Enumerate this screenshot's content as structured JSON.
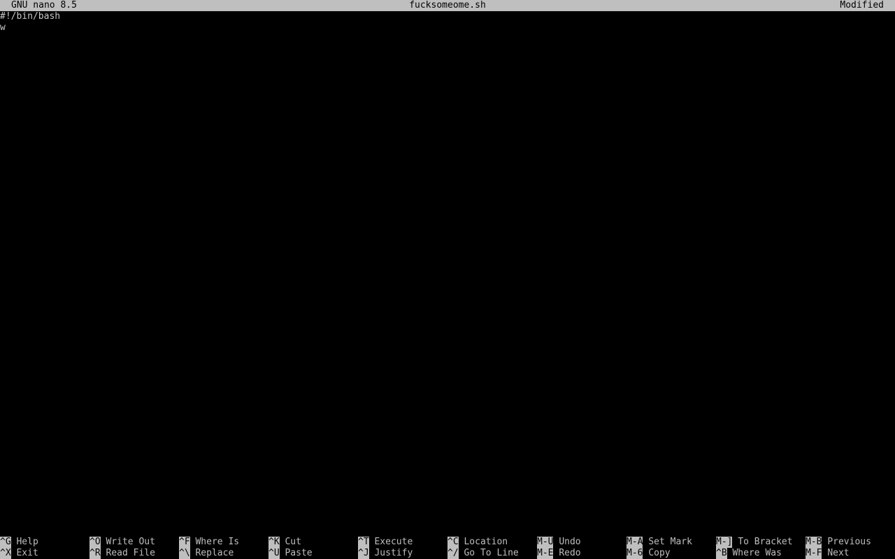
{
  "titlebar": {
    "version": "GNU nano 8.5",
    "filename": "fucksomeome.sh",
    "state": "Modified"
  },
  "editor": {
    "lines": [
      "#!/bin/bash",
      "w"
    ]
  },
  "shortcuts": {
    "row1": [
      {
        "key": "^G",
        "label": "Help"
      },
      {
        "key": "^O",
        "label": "Write Out"
      },
      {
        "key": "^F",
        "label": "Where Is"
      },
      {
        "key": "^K",
        "label": "Cut"
      },
      {
        "key": "^T",
        "label": "Execute"
      },
      {
        "key": "^C",
        "label": "Location"
      },
      {
        "key": "M-U",
        "label": "Undo"
      },
      {
        "key": "M-A",
        "label": "Set Mark"
      },
      {
        "key": "M-]",
        "label": "To Bracket"
      },
      {
        "key": "M-B",
        "label": "Previous"
      }
    ],
    "row2": [
      {
        "key": "^X",
        "label": "Exit"
      },
      {
        "key": "^R",
        "label": "Read File"
      },
      {
        "key": "^\\",
        "label": "Replace"
      },
      {
        "key": "^U",
        "label": "Paste"
      },
      {
        "key": "^J",
        "label": "Justify"
      },
      {
        "key": "^/",
        "label": "Go To Line"
      },
      {
        "key": "M-E",
        "label": "Redo"
      },
      {
        "key": "M-6",
        "label": "Copy"
      },
      {
        "key": "^B",
        "label": "Where Was"
      },
      {
        "key": "M-F",
        "label": "Next"
      }
    ]
  }
}
